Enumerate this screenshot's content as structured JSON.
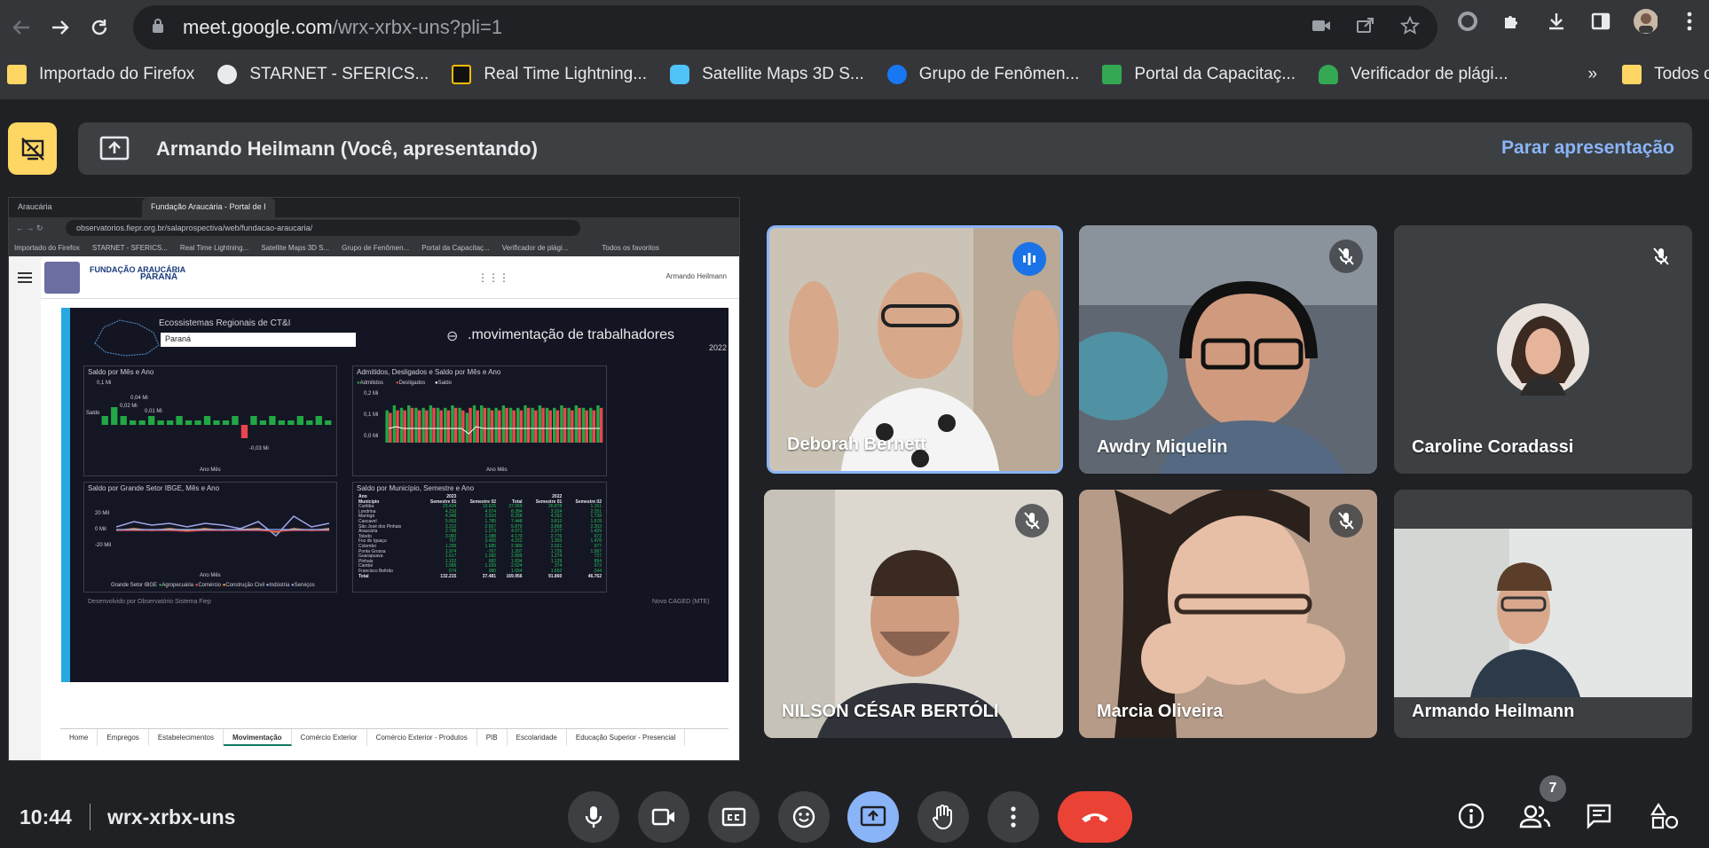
{
  "browser": {
    "url_host": "meet.google.com",
    "url_path": "/wrx-xrbx-uns?pli=1",
    "bookmarks": [
      {
        "label": "Importado do Firefox",
        "icon": "folder-icon",
        "color": "#fdd663"
      },
      {
        "label": "STARNET - SFERICS...",
        "icon": "globe-icon",
        "color": "#e8eaed"
      },
      {
        "label": "Real Time Lightning...",
        "icon": "lightning-icon",
        "color": "#fbbc04"
      },
      {
        "label": "Satellite Maps 3D S...",
        "icon": "satellite-icon",
        "color": "#4fc3f7"
      },
      {
        "label": "Grupo de Fenômen...",
        "icon": "facebook-icon",
        "color": "#1877f2"
      },
      {
        "label": "Portal da Capacitaç...",
        "icon": "portal-icon",
        "color": "#34a853"
      },
      {
        "label": "Verificador de plági...",
        "icon": "verifier-icon",
        "color": "#34a853"
      }
    ],
    "bookmarks_more": "»",
    "all_bookmarks": "Todos os favoritos"
  },
  "meet": {
    "presenter_banner": "Armando Heilmann (Você, apresentando)",
    "stop_presenting": "Parar apresentação",
    "time": "10:44",
    "meeting_code": "wrx-xrbx-uns",
    "participants_count": "7",
    "tiles": [
      {
        "name": "Deborah Bernett",
        "state": "speaking",
        "bg": "#c9c0b0"
      },
      {
        "name": "Awdry Miquelin",
        "state": "muted",
        "bg": "#6c7680"
      },
      {
        "name": "Caroline Coradassi",
        "state": "muted",
        "bg": "#3c4043"
      },
      {
        "name": "NILSON CÉSAR BERTÓLI",
        "state": "muted",
        "bg": "#d8d4cc"
      },
      {
        "name": "Marcia Oliveira",
        "state": "muted",
        "bg": "#b59a86"
      },
      {
        "name": "Armando Heilmann",
        "state": "none",
        "bg": "#cfd2d4"
      }
    ]
  },
  "shared_screen": {
    "tabs": [
      "Araucária",
      "Fundação Araucária - Portal de I"
    ],
    "url": "observatorios.fiepr.org.br/salaprospectiva/web/fundacao-araucaria/",
    "bookmarks": [
      "Importado do Firefox",
      "STARNET - SFERICS...",
      "Real Time Lightning...",
      "Satellite Maps 3D S...",
      "Grupo de Fenômen...",
      "Portal da Capacitaç...",
      "Verificador de plági...",
      "Todos os favoritos"
    ],
    "org_name": "FUNDAÇÃO ARAUCÁRIA",
    "state_name": "PARANÁ",
    "user": "Armando Heilmann",
    "dashboard": {
      "region_label": "Ecossistemas Regionais de CT&I",
      "region_value": "Paraná",
      "title": ".movimentação de trabalhadores",
      "year": "2022",
      "panel1": {
        "title": "Saldo por Mês e Ano",
        "ylabel": "Saldo",
        "xlabel": "Ano Mês",
        "top": "0,1 Mi",
        "low": "-0,03 Mi",
        "peak": "0,04 Mi",
        "first": "0,02 Mi",
        "common": "0,01 Mi"
      },
      "panel2": {
        "title": "Admitidos, Desligados e Saldo por Mês e Ano",
        "legend": [
          "Admitidos",
          "Desligados",
          "Saldo"
        ],
        "ylabel": "Admitidos e Desligados",
        "xlabel": "Ano Mês",
        "ticks": [
          "0,2 Mi",
          "0,1 Mi",
          "0,0 Mi"
        ]
      },
      "panel3": {
        "title": "Saldo por Grande Setor IBGE, Mês e Ano",
        "ylabel": "Saldo",
        "xlabel": "Ano Mês",
        "ticks": [
          "20 Mil",
          "0 Mil",
          "-20 Mil"
        ],
        "legend_title": "Grande Setor IBGE",
        "legend": [
          "Agropecuária",
          "Comércio",
          "Construção Civil",
          "Indústria",
          "Serviços"
        ]
      },
      "panel4": {
        "title": "Saldo por Município, Semestre e Ano",
        "header": [
          "Ano",
          "2023",
          "",
          "",
          "2022",
          ""
        ],
        "subheader": [
          "Município",
          "Semestre 01",
          "Semestre 02",
          "Total",
          "Semestre 01",
          "Semestre 02"
        ],
        "rows": [
          [
            "Curitiba",
            "23.434",
            "13.626",
            "37.060",
            "26.878",
            "1.151"
          ],
          [
            "Londrina",
            "4.210",
            "4.074",
            "8.284",
            "3.324",
            "2.251"
          ],
          [
            "Maringá",
            "4.348",
            "3.910",
            "8.258",
            "4.262",
            "1.728"
          ],
          [
            "Cascavel",
            "5.663",
            "1.785",
            "7.448",
            "3.812",
            "1.578"
          ],
          [
            "São José dos Pinhais",
            "3.312",
            "2.567",
            "5.879",
            "3.858",
            "2.203"
          ],
          [
            "Araucária",
            "2.798",
            "1.273",
            "4.071",
            "2.377",
            "1.429"
          ],
          [
            "Toledo",
            "3.082",
            "1.088",
            "4.170",
            "2.776",
            "972"
          ],
          [
            "Foz do Iguaçu",
            "767",
            "3.455",
            "4.222",
            "1.303",
            "1.478"
          ],
          [
            "Colombo",
            "1.295",
            "1.685",
            "2.980",
            "2.021",
            "977"
          ],
          [
            "Ponta Grossa",
            "1.974",
            "-767",
            "1.207",
            "1.729",
            "1.587"
          ],
          [
            "Guarapuava",
            "1.617",
            "1.282",
            "2.899",
            "1.274",
            "727"
          ],
          [
            "Pinhais",
            "1.152",
            "682",
            "1.834",
            "1.129",
            "894"
          ],
          [
            "Cambé",
            "1.585",
            "1.039",
            "2.624",
            "374",
            "572"
          ],
          [
            "Francisco Beltrão",
            "674",
            "980",
            "1.654",
            "1.652",
            "244"
          ],
          [
            "Total",
            "132.215",
            "37.481",
            "169.956",
            "91.860",
            "46.762"
          ]
        ]
      },
      "footer_left": "Desenvolvido por Observatório Sistema Fiep",
      "footer_right": "Novo CAGED (MTE)",
      "tabs": [
        "Home",
        "Empregos",
        "Estabelecimentos",
        "Movimentação",
        "Comércio Exterior",
        "Comércio Exterior - Produtos",
        "PIB",
        "Escolaridade",
        "Educação Superior - Presencial"
      ],
      "active_tab": "Movimentação"
    }
  },
  "chart_data": [
    {
      "type": "bar",
      "title": "Saldo por Mês e Ano",
      "ylabel": "Saldo",
      "xlabel": "Ano Mês",
      "values": [
        0.02,
        0.04,
        0.02,
        0.01,
        0.01,
        0.02,
        0.01,
        0.01,
        0.02,
        0.01,
        0.01,
        0.02,
        0.01,
        0.01,
        0.02,
        -0.03,
        0.02,
        0.01,
        0.02,
        0.01,
        0.01,
        0.02,
        0.01,
        0.02,
        0.01
      ],
      "colors": {
        "positive": "#21a845",
        "negative": "#e8474f"
      }
    },
    {
      "type": "bar",
      "title": "Admitidos, Desligados e Saldo por Mês e Ano",
      "series": [
        {
          "name": "Admitidos",
          "values": [
            0.13,
            0.15,
            0.14,
            0.15,
            0.14,
            0.14,
            0.15,
            0.14,
            0.14,
            0.15,
            0.14,
            0.12,
            0.15,
            0.15,
            0.14,
            0.14,
            0.15,
            0.14,
            0.14,
            0.15,
            0.14,
            0.15,
            0.14,
            0.14,
            0.15,
            0.14,
            0.15,
            0.14,
            0.14,
            0.15
          ],
          "color": "#21a845"
        },
        {
          "name": "Desligados",
          "values": [
            0.12,
            0.13,
            0.13,
            0.14,
            0.13,
            0.13,
            0.14,
            0.13,
            0.13,
            0.14,
            0.13,
            0.14,
            0.13,
            0.14,
            0.13,
            0.13,
            0.14,
            0.13,
            0.13,
            0.14,
            0.13,
            0.14,
            0.13,
            0.13,
            0.14,
            0.13,
            0.14,
            0.13,
            0.13,
            0.14
          ],
          "color": "#e8474f"
        }
      ],
      "ylim": [
        0,
        0.2
      ]
    }
  ]
}
